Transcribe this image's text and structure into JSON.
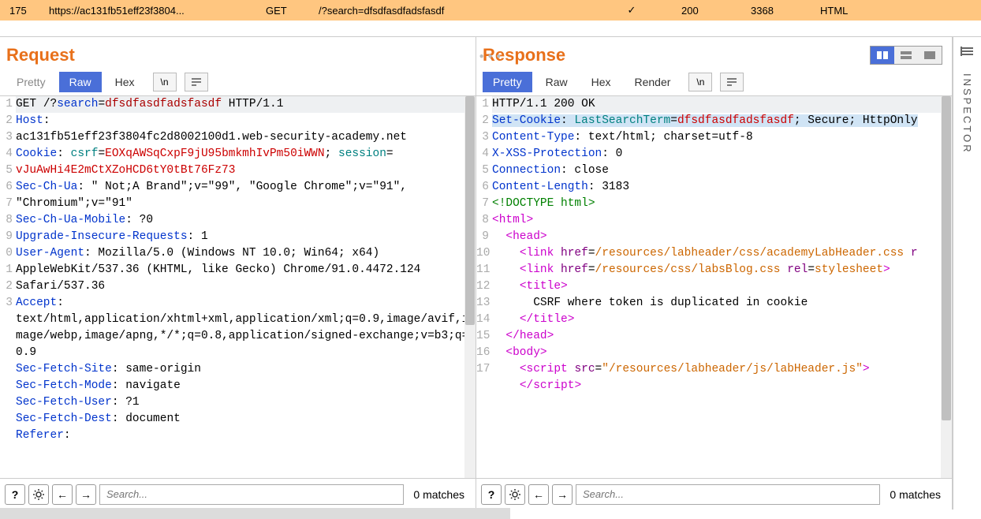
{
  "topbar": {
    "id": "175",
    "url": "https://ac131fb51eff23f3804...",
    "method": "GET",
    "path": "/?search=dfsdfasdfadsfasdf",
    "edited": "✓",
    "status": "200",
    "size": "3368",
    "type": "HTML"
  },
  "request": {
    "title": "Request",
    "tabs": {
      "pretty": "Pretty",
      "raw": "Raw",
      "hex": "Hex",
      "newline": "\\n"
    },
    "lines": [
      {
        "n": "1",
        "parts": [
          {
            "t": "GET ",
            "c": "c-black"
          },
          {
            "t": "/?",
            "c": "c-black"
          },
          {
            "t": "search",
            "c": "c-blue"
          },
          {
            "t": "=",
            "c": "c-black"
          },
          {
            "t": "dfsdfasdfadsfasdf",
            "c": "c-darkred"
          },
          {
            "t": " HTTP/1.1",
            "c": "c-black"
          }
        ],
        "hl": true
      },
      {
        "n": "2",
        "parts": [
          {
            "t": "Host",
            "c": "c-blue"
          },
          {
            "t": ": ",
            "c": "c-black"
          }
        ]
      },
      {
        "cont": true,
        "parts": [
          {
            "t": "ac131fb51eff23f3804fc2d8002100d1.web-security-academy.net",
            "c": "c-black"
          }
        ]
      },
      {
        "n": "3",
        "parts": [
          {
            "t": "Cookie",
            "c": "c-blue"
          },
          {
            "t": ": ",
            "c": "c-black"
          },
          {
            "t": "csrf",
            "c": "c-teal"
          },
          {
            "t": "=",
            "c": "c-black"
          },
          {
            "t": "EOXqAWSqCxpF9jU95bmkmhIvPm50iWWN",
            "c": "c-red"
          },
          {
            "t": "; ",
            "c": "c-black"
          },
          {
            "t": "session",
            "c": "c-teal"
          },
          {
            "t": "=",
            "c": "c-black"
          }
        ]
      },
      {
        "cont": true,
        "parts": [
          {
            "t": "vJuAwHi4E2mCtXZoHCD6tY0tBt76Fz73",
            "c": "c-red"
          }
        ]
      },
      {
        "n": "4",
        "parts": [
          {
            "t": "Sec-Ch-Ua",
            "c": "c-blue"
          },
          {
            "t": ": \" Not;A Brand\";v=\"99\", \"Google Chrome\";v=\"91\", ",
            "c": "c-black"
          }
        ]
      },
      {
        "cont": true,
        "parts": [
          {
            "t": "\"Chromium\";v=\"91\"",
            "c": "c-black"
          }
        ]
      },
      {
        "n": "5",
        "parts": [
          {
            "t": "Sec-Ch-Ua-Mobile",
            "c": "c-blue"
          },
          {
            "t": ": ?0",
            "c": "c-black"
          }
        ]
      },
      {
        "n": "6",
        "parts": [
          {
            "t": "Upgrade-Insecure-Requests",
            "c": "c-blue"
          },
          {
            "t": ": 1",
            "c": "c-black"
          }
        ]
      },
      {
        "n": "7",
        "parts": [
          {
            "t": "User-Agent",
            "c": "c-blue"
          },
          {
            "t": ": Mozilla/5.0 (Windows NT 10.0; Win64; x64) ",
            "c": "c-black"
          }
        ]
      },
      {
        "cont": true,
        "parts": [
          {
            "t": "AppleWebKit/537.36 (KHTML, like Gecko) Chrome/91.0.4472.124 ",
            "c": "c-black"
          }
        ]
      },
      {
        "cont": true,
        "parts": [
          {
            "t": "Safari/537.36",
            "c": "c-black"
          }
        ]
      },
      {
        "n": "8",
        "parts": [
          {
            "t": "Accept",
            "c": "c-blue"
          },
          {
            "t": ": ",
            "c": "c-black"
          }
        ]
      },
      {
        "cont": true,
        "parts": [
          {
            "t": "text/html,application/xhtml+xml,application/xml;q=0.9,image/avif,image/webp,image/apng,*/*;q=0.8,application/signed-exchange;v=b3;q=0.9",
            "c": "c-black"
          }
        ]
      },
      {
        "n": "9",
        "parts": [
          {
            "t": "Sec-Fetch-Site",
            "c": "c-blue"
          },
          {
            "t": ": same-origin",
            "c": "c-black"
          }
        ]
      },
      {
        "n": "0",
        "parts": [
          {
            "t": "Sec-Fetch-Mode",
            "c": "c-blue"
          },
          {
            "t": ": navigate",
            "c": "c-black"
          }
        ]
      },
      {
        "n": "1",
        "parts": [
          {
            "t": "Sec-Fetch-User",
            "c": "c-blue"
          },
          {
            "t": ": ?1",
            "c": "c-black"
          }
        ]
      },
      {
        "n": "2",
        "parts": [
          {
            "t": "Sec-Fetch-Dest",
            "c": "c-blue"
          },
          {
            "t": ": document",
            "c": "c-black"
          }
        ]
      },
      {
        "n": "3",
        "parts": [
          {
            "t": "Referer",
            "c": "c-blue"
          },
          {
            "t": ": ",
            "c": "c-black"
          }
        ]
      }
    ],
    "search_placeholder": "Search...",
    "matches": "0 matches"
  },
  "response": {
    "title": "Response",
    "tabs": {
      "pretty": "Pretty",
      "raw": "Raw",
      "hex": "Hex",
      "render": "Render",
      "newline": "\\n"
    },
    "lines": [
      {
        "n": "1",
        "parts": [
          {
            "t": "HTTP/1.1 200 OK",
            "c": "c-black"
          }
        ],
        "hl": true
      },
      {
        "n": "2",
        "parts": [
          {
            "t": "Set-Cookie",
            "c": "c-blue",
            "sel": true
          },
          {
            "t": ": ",
            "c": "c-black",
            "sel": true
          },
          {
            "t": "LastSearchTerm",
            "c": "c-teal",
            "sel": true
          },
          {
            "t": "=",
            "c": "c-black",
            "sel": true
          },
          {
            "t": "dfsdfasdfadsfasdf",
            "c": "c-red",
            "sel": true
          },
          {
            "t": "; Secure; HttpOnly",
            "c": "c-black",
            "sel": true
          }
        ]
      },
      {
        "n": "3",
        "parts": [
          {
            "t": "Content-Type",
            "c": "c-blue"
          },
          {
            "t": ": text/html; charset=utf-8",
            "c": "c-black"
          }
        ]
      },
      {
        "n": "4",
        "parts": [
          {
            "t": "X-XSS-Protection",
            "c": "c-blue"
          },
          {
            "t": ": 0",
            "c": "c-black"
          }
        ]
      },
      {
        "n": "5",
        "parts": [
          {
            "t": "Connection",
            "c": "c-blue"
          },
          {
            "t": ": close",
            "c": "c-black"
          }
        ]
      },
      {
        "n": "6",
        "parts": [
          {
            "t": "Content-Length",
            "c": "c-blue"
          },
          {
            "t": ": 3183",
            "c": "c-black"
          }
        ]
      },
      {
        "n": "7",
        "parts": [
          {
            "t": "",
            "c": "c-black"
          }
        ]
      },
      {
        "n": "8",
        "parts": [
          {
            "t": "<!DOCTYPE html>",
            "c": "c-darkgreen"
          }
        ]
      },
      {
        "n": "9",
        "parts": [
          {
            "t": "<",
            "c": "c-magenta"
          },
          {
            "t": "html",
            "c": "c-magenta"
          },
          {
            "t": ">",
            "c": "c-magenta"
          }
        ]
      },
      {
        "n": "10",
        "parts": [
          {
            "t": "  <",
            "c": "c-magenta"
          },
          {
            "t": "head",
            "c": "c-magenta"
          },
          {
            "t": ">",
            "c": "c-magenta"
          }
        ]
      },
      {
        "n": "11",
        "parts": [
          {
            "t": "    <",
            "c": "c-magenta"
          },
          {
            "t": "link",
            "c": "c-magenta"
          },
          {
            "t": " ",
            "c": "c-black"
          },
          {
            "t": "href",
            "c": "c-purple"
          },
          {
            "t": "=",
            "c": "c-black"
          },
          {
            "t": "/resources/labheader/css/academyLabHeader.css",
            "c": "c-orange"
          },
          {
            "t": " r",
            "c": "c-purple"
          }
        ]
      },
      {
        "n": "12",
        "parts": [
          {
            "t": "    <",
            "c": "c-magenta"
          },
          {
            "t": "link",
            "c": "c-magenta"
          },
          {
            "t": " ",
            "c": "c-black"
          },
          {
            "t": "href",
            "c": "c-purple"
          },
          {
            "t": "=",
            "c": "c-black"
          },
          {
            "t": "/resources/css/labsBlog.css",
            "c": "c-orange"
          },
          {
            "t": " ",
            "c": "c-black"
          },
          {
            "t": "rel",
            "c": "c-purple"
          },
          {
            "t": "=",
            "c": "c-black"
          },
          {
            "t": "stylesheet",
            "c": "c-orange"
          },
          {
            "t": ">",
            "c": "c-magenta"
          }
        ]
      },
      {
        "n": "13",
        "parts": [
          {
            "t": "    <",
            "c": "c-magenta"
          },
          {
            "t": "title",
            "c": "c-magenta"
          },
          {
            "t": ">",
            "c": "c-magenta"
          }
        ]
      },
      {
        "cont": true,
        "parts": [
          {
            "t": "      CSRF where token is duplicated in cookie",
            "c": "c-black"
          }
        ]
      },
      {
        "cont": true,
        "parts": [
          {
            "t": "    </",
            "c": "c-magenta"
          },
          {
            "t": "title",
            "c": "c-magenta"
          },
          {
            "t": ">",
            "c": "c-magenta"
          }
        ]
      },
      {
        "n": "14",
        "parts": [
          {
            "t": "  </",
            "c": "c-magenta"
          },
          {
            "t": "head",
            "c": "c-magenta"
          },
          {
            "t": ">",
            "c": "c-magenta"
          }
        ]
      },
      {
        "n": "15",
        "parts": [
          {
            "t": "  <",
            "c": "c-magenta"
          },
          {
            "t": "body",
            "c": "c-magenta"
          },
          {
            "t": ">",
            "c": "c-magenta"
          }
        ]
      },
      {
        "n": "16",
        "parts": [
          {
            "t": "    <",
            "c": "c-magenta"
          },
          {
            "t": "script",
            "c": "c-magenta"
          },
          {
            "t": " ",
            "c": "c-black"
          },
          {
            "t": "src",
            "c": "c-purple"
          },
          {
            "t": "=",
            "c": "c-black"
          },
          {
            "t": "\"/resources/labheader/js/labHeader.js\"",
            "c": "c-orange"
          },
          {
            "t": ">",
            "c": "c-magenta"
          }
        ]
      },
      {
        "cont": true,
        "parts": [
          {
            "t": "    </",
            "c": "c-magenta"
          },
          {
            "t": "script",
            "c": "c-magenta"
          },
          {
            "t": ">",
            "c": "c-magenta"
          }
        ]
      },
      {
        "n": "17",
        "parts": [
          {
            "t": "",
            "c": "c-black"
          }
        ]
      }
    ],
    "search_placeholder": "Search...",
    "matches": "0 matches"
  },
  "inspector": {
    "label": "INSPECTOR"
  }
}
